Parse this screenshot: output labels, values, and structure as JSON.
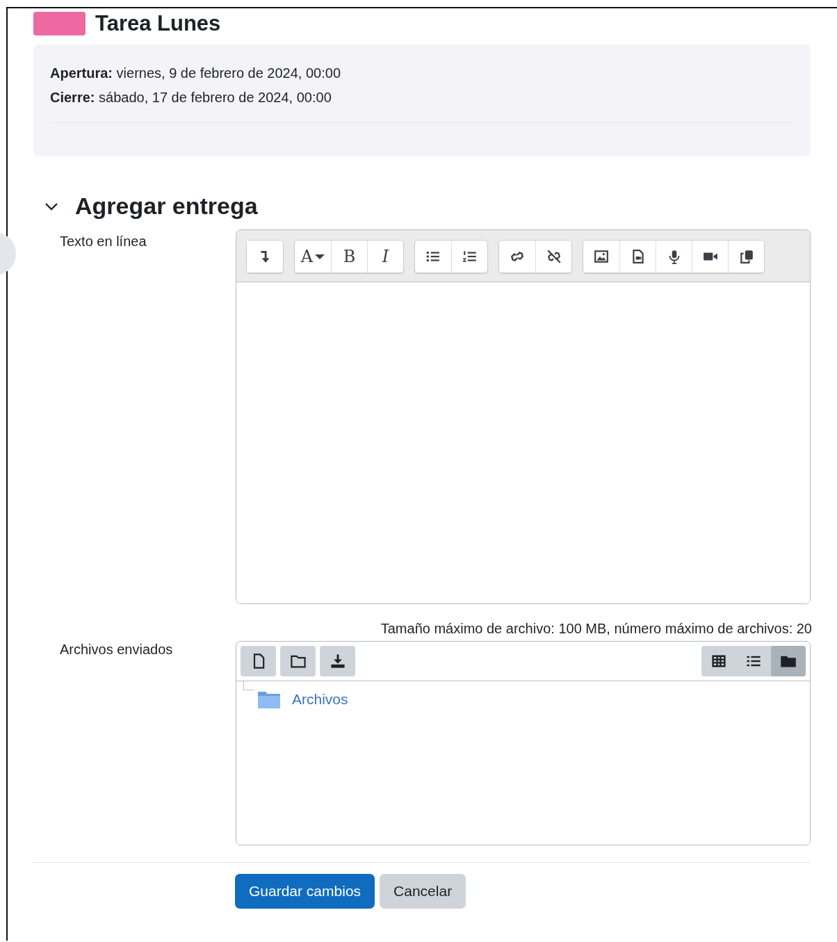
{
  "activity": {
    "title": "Tarea Lunes"
  },
  "dates": [
    "**Apertura:** viernes, 9 de febrero de 2024, 00:00",
    "**Cierre:** sábado, 17 de febrero de 2024, 00:00"
  ],
  "section": {
    "title": "Agregar entrega",
    "expanded": true
  },
  "online_text": {
    "label": "Texto en línea",
    "toolbar_groups": [
      {
        "buttons": [
          {
            "kind": "redo"
          }
        ]
      },
      {
        "buttons": [
          {
            "kind": "font",
            "label": "A"
          },
          {
            "kind": "bold",
            "label": "B"
          },
          {
            "kind": "italic",
            "label": "I"
          }
        ]
      },
      {
        "buttons": [
          {
            "kind": "bullets"
          },
          {
            "kind": "numbers"
          }
        ]
      },
      {
        "buttons": [
          {
            "kind": "link"
          },
          {
            "kind": "unlink"
          }
        ]
      },
      {
        "buttons": [
          {
            "kind": "image"
          },
          {
            "kind": "media"
          },
          {
            "kind": "audio"
          },
          {
            "kind": "video"
          },
          {
            "kind": "copy"
          }
        ]
      }
    ]
  },
  "files": {
    "label": "Archivos enviados",
    "limits": "Tamaño máximo de archivo: 100 MB, número máximo de archivos: 20",
    "actions": [
      {
        "kind": "file"
      },
      {
        "kind": "folder"
      },
      {
        "kind": "download"
      }
    ],
    "views": [
      {
        "kind": "grid",
        "selected": false
      },
      {
        "kind": "list",
        "selected": false
      },
      {
        "kind": "tree",
        "selected": true
      }
    ],
    "tree": [
      {
        "name": "Archivos"
      }
    ]
  },
  "buttons": [
    {
      "label": "Guardar cambios",
      "kind": "primary"
    },
    {
      "label": "Cancelar",
      "kind": "secondary"
    }
  ]
}
